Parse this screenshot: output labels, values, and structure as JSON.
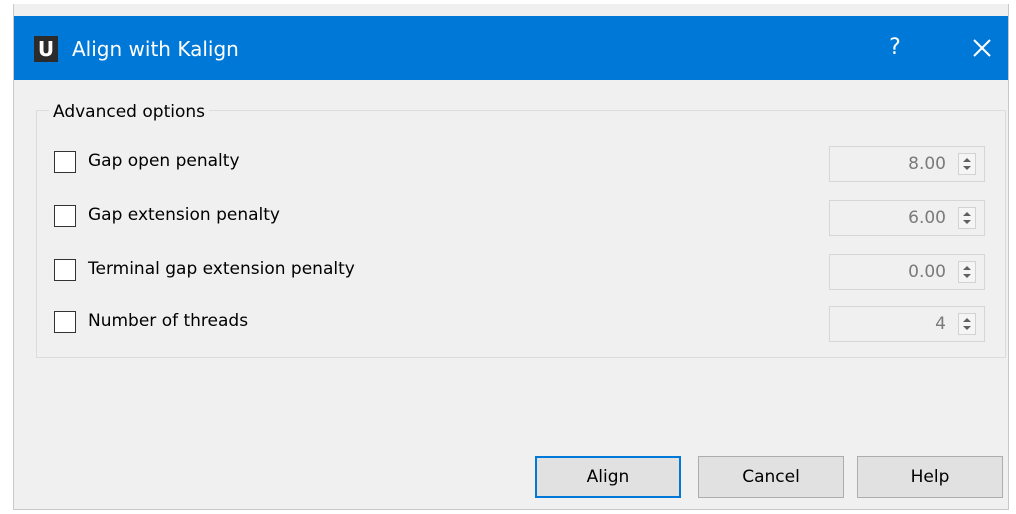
{
  "window": {
    "title": "Align with Kalign",
    "icon_letter": "U",
    "help_glyph": "?",
    "accent_color": "#0078d7"
  },
  "advanced": {
    "title": "Advanced options",
    "options": [
      {
        "label": "Gap open penalty",
        "value": "8.00",
        "checked": false
      },
      {
        "label": "Gap extension penalty",
        "value": "6.00",
        "checked": false
      },
      {
        "label": "Terminal gap extension penalty",
        "value": "0.00",
        "checked": false
      },
      {
        "label": "Number of threads",
        "value": "4",
        "checked": false
      }
    ]
  },
  "buttons": {
    "align": "Align",
    "cancel": "Cancel",
    "help": "Help"
  }
}
